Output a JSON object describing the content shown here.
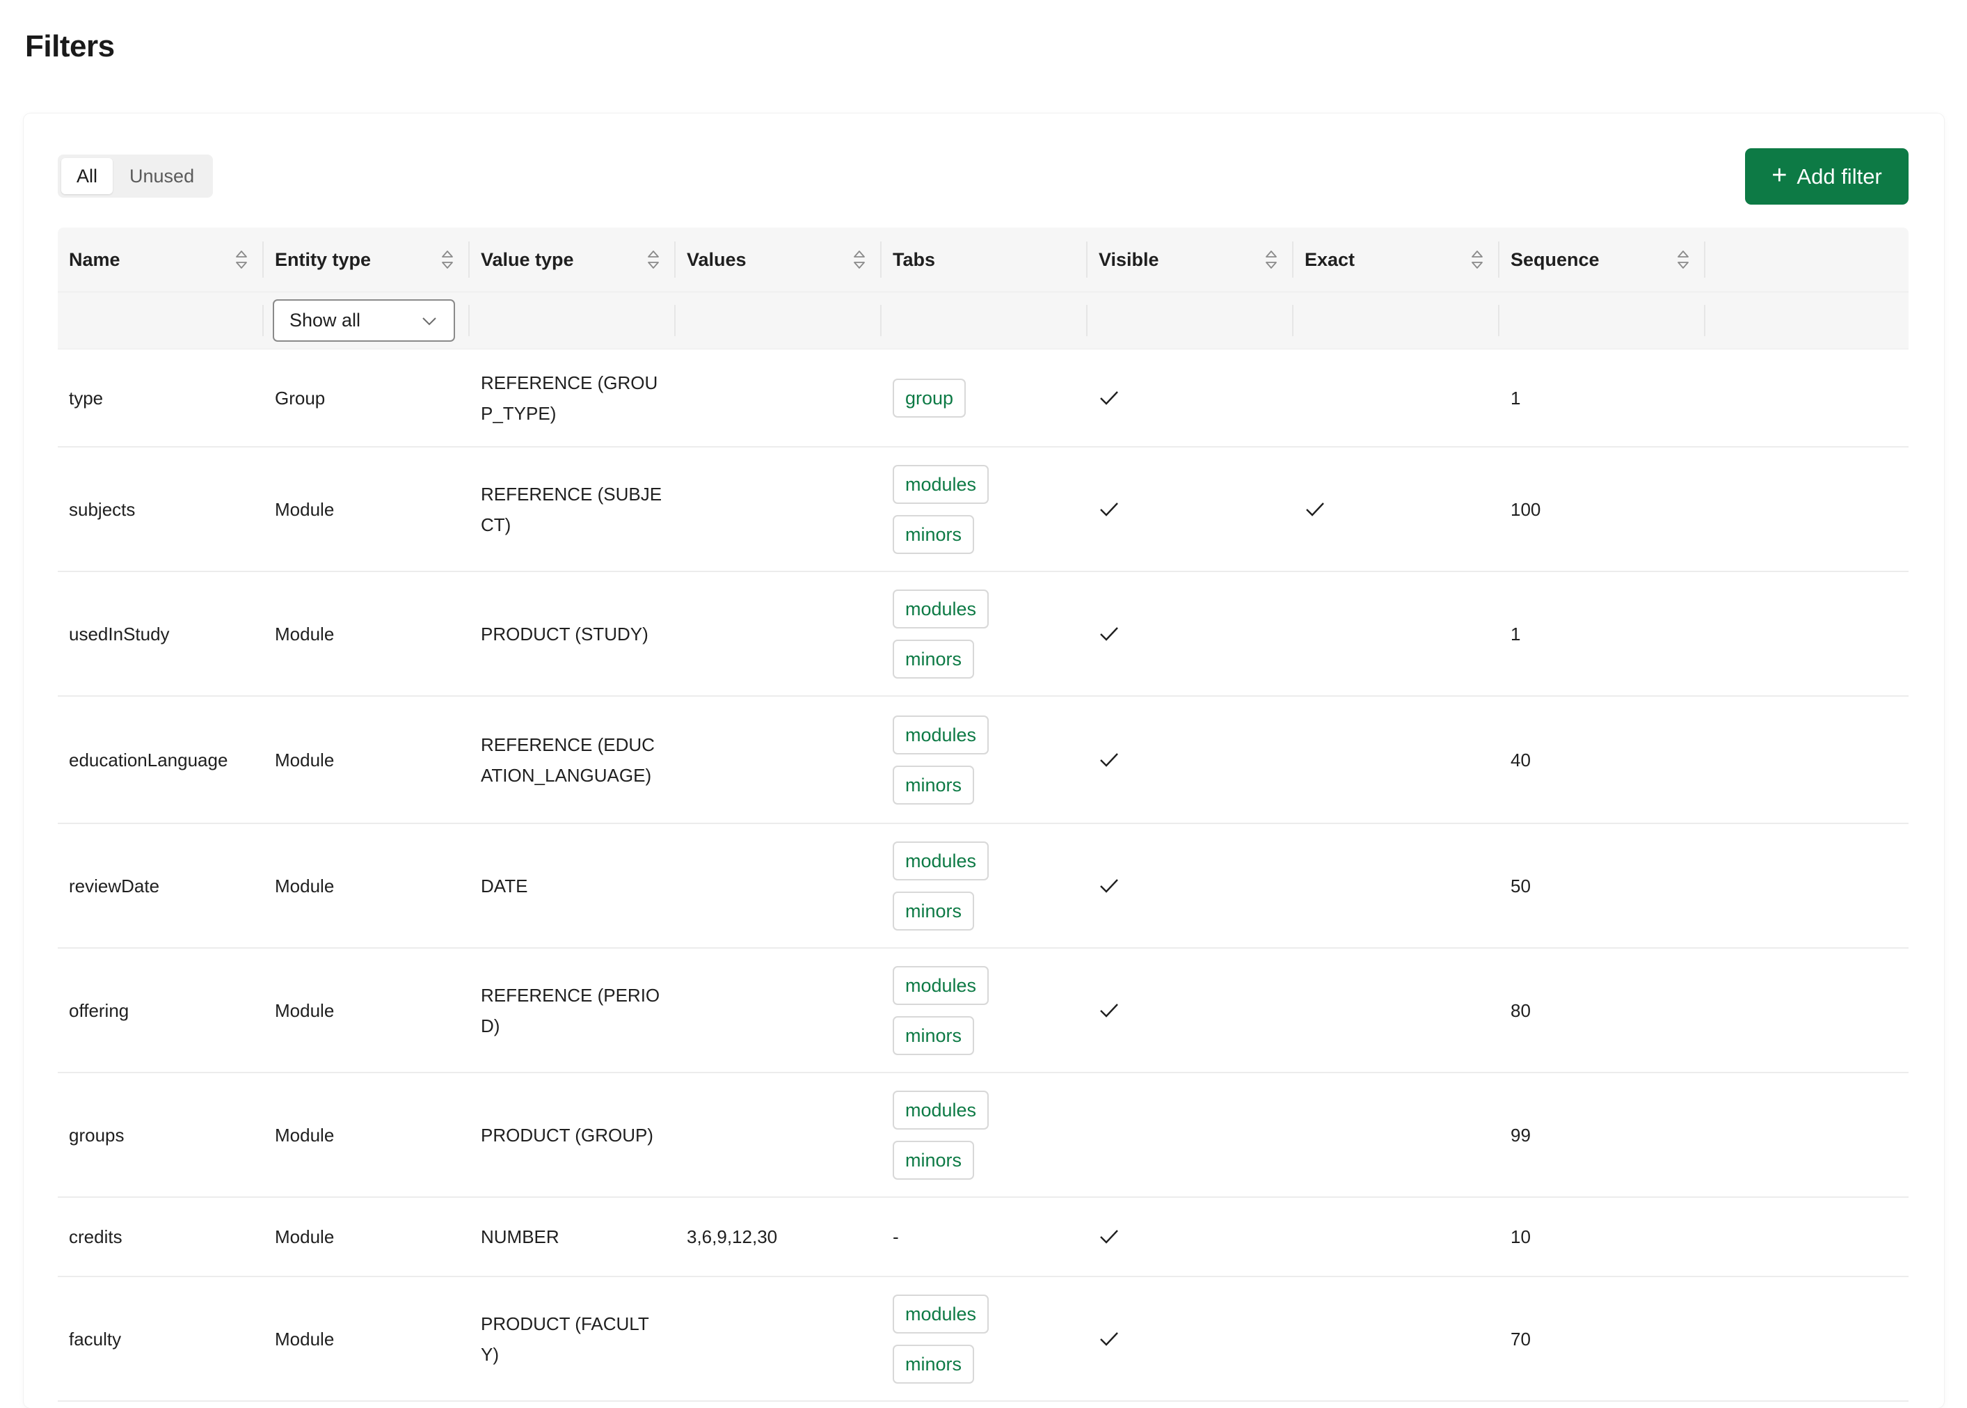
{
  "page": {
    "title": "Filters"
  },
  "segmented": {
    "options": [
      "All",
      "Unused"
    ],
    "selected": "All"
  },
  "add_button": {
    "label": "Add filter"
  },
  "columns": [
    "Name",
    "Entity type",
    "Value type",
    "Values",
    "Tabs",
    "Visible",
    "Exact",
    "Sequence"
  ],
  "filter_row": {
    "entity_type_select": "Show all"
  },
  "rows": [
    {
      "name": "type",
      "entity_type": "Group",
      "value_type": "REFERENCE (GROUP_TYPE)",
      "values": "",
      "tabs": [
        "group"
      ],
      "visible": true,
      "exact": false,
      "sequence": "1"
    },
    {
      "name": "subjects",
      "entity_type": "Module",
      "value_type": "REFERENCE (SUBJECT)",
      "values": "",
      "tabs": [
        "modules",
        "minors"
      ],
      "visible": true,
      "exact": true,
      "sequence": "100"
    },
    {
      "name": "usedInStudy",
      "entity_type": "Module",
      "value_type": "PRODUCT (STUDY)",
      "values": "",
      "tabs": [
        "modules",
        "minors"
      ],
      "visible": true,
      "exact": false,
      "sequence": "1"
    },
    {
      "name": "educationLanguage",
      "entity_type": "Module",
      "value_type": "REFERENCE (EDUCATION_LANGUAGE)",
      "values": "",
      "tabs": [
        "modules",
        "minors"
      ],
      "visible": true,
      "exact": false,
      "sequence": "40"
    },
    {
      "name": "reviewDate",
      "entity_type": "Module",
      "value_type": "DATE",
      "values": "",
      "tabs": [
        "modules",
        "minors"
      ],
      "visible": true,
      "exact": false,
      "sequence": "50"
    },
    {
      "name": "offering",
      "entity_type": "Module",
      "value_type": "REFERENCE (PERIOD)",
      "values": "",
      "tabs": [
        "modules",
        "minors"
      ],
      "visible": true,
      "exact": false,
      "sequence": "80"
    },
    {
      "name": "groups",
      "entity_type": "Module",
      "value_type": "PRODUCT (GROUP)",
      "values": "",
      "tabs": [
        "modules",
        "minors"
      ],
      "visible": false,
      "exact": false,
      "sequence": "99"
    },
    {
      "name": "credits",
      "entity_type": "Module",
      "value_type": "NUMBER",
      "values": "3,6,9,12,30",
      "tabs_text": "-",
      "tabs": [],
      "visible": true,
      "exact": false,
      "sequence": "10"
    },
    {
      "name": "faculty",
      "entity_type": "Module",
      "value_type": "PRODUCT (FACULTY)",
      "values": "",
      "tabs": [
        "modules",
        "minors"
      ],
      "visible": true,
      "exact": false,
      "sequence": "70"
    }
  ],
  "colors": {
    "accent": "#0d7a45",
    "tag_border": "#d8d8d8",
    "header_bg": "#f6f6f6"
  },
  "icons": {
    "sort": "sort-icon",
    "check": "checkmark-icon",
    "plus": "plus-icon",
    "chevron": "chevron-down-icon"
  }
}
